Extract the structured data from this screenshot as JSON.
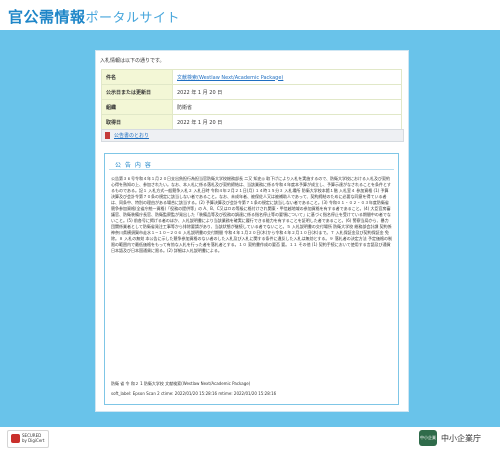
{
  "header": {
    "title_strong": "官公需情報",
    "title_light": "ポータルサイト"
  },
  "panel": {
    "intro": "入札情報は以下の通りです。",
    "rows": [
      {
        "key": "件名",
        "value": "文献検索(Westlaw Next/Academic Package)"
      },
      {
        "key": "公示日または更新日",
        "value": "2022 年 1 月 20 日"
      },
      {
        "key": "組織",
        "value": "防衛省"
      },
      {
        "key": "取得日",
        "value": "2022 年 1 月 20 日"
      }
    ],
    "announcement_link": "公告書のとおり"
  },
  "notice": {
    "title": "公 告 内 容",
    "body": "公告第３６号令和４年１月２０日支出負担行為担当官防衛大学校総務部長 二又 知史◎ 取下げにより入札を実施するので、防衛大学校における入札及び契約心得を熟知の上、参加されたい。なお、本入札に係る落札及び契約締結は、当該業務に係る令和４年度本予算が成立し、予算示達がなされることを条件とするものである。記１ 入札方式一般競争入札２ 入札日時 令和４年２月２１日(月) １４時１５分３ 入札場所 防衛大学校本館１階 入札室４ 参加資格 (1) 予算決算及び会計令第７０条の規定に該当しない者であること。なお、未成年者、被保佐人又は被補助人であって、契約締結のために必要な同意を得ている者は、同条中、特別の理由がある場合に該当する。(2) 予算決算及び会計令第７１条の規定に該当しない者であること。(3) 令和０１・０２・０３年度防衛省競争参加資格(全省庁統一資格)「役務の提供等」の A、B、C又はＤの等級に格付けされ関東・甲信越地域の参加資格を有する者であること。(4) 大臣官房審議官、防衛装備庁長官、防衛監察監が発出した「装備品等及び役務の調達に係る指名停止等の要領について」に基づく指名停止を受けている期間中の者でないこと。(5) 前各号に掲げる者のほか、入札説明書により当該業務を確実に履行できる能力を有することを証明した者であること。(6) 警察当局から、暴力団関係業者として防衛省発注工事等から排除要請があり、当該状態が継続している者でないこと。５ 入札説明書の交付場所 防衛大学校 総務部会計課 契約係 神奈川県横須賀市走水１−１０−２０６ 入札説明書の交付期間 令和４年１月２０日(木)から令和４年２月１０日(木)まで。７ 入札保証金及び契約保証金 免除。８ 入札の無効 本公告に示した競争参加資格のない者のした入札及び入札に関する条件に違反した入札は無効とする。９ 落札者の決定方法 予定価格の制限の範囲内で最低価格をもって有効な入札を行った者を落札者とする。１０ 契約書作成の要否 要。１１ その他 (1) 契約手続において使用する言語及び通貨 日本語及び日本国通貨に限る。(2) 詳細は入札説明書による。",
    "signature": "防衛 省 令 和２ 1 防衛大学校 文献検索(Westlaw Next/Academic Package)",
    "ocr_note": "soft_label: Epson Scan 2 ctime: 2022/01/20 15:28:16 mtime: 2022/01/20 15:28:16"
  },
  "footer": {
    "seal_line1": "SECURED",
    "seal_line2": "by DigiCert",
    "org_badge": "中小企業",
    "org_name": "中小企業庁"
  },
  "colors": {
    "background": "#69c3ea",
    "brand_blue": "#1f86c8",
    "table_key_bg": "#f3f7d6",
    "link": "#1f6fc1"
  },
  "icons": {
    "announcement": "pdf-icon",
    "seal": "lock-icon",
    "org": "agency-logo-icon"
  }
}
